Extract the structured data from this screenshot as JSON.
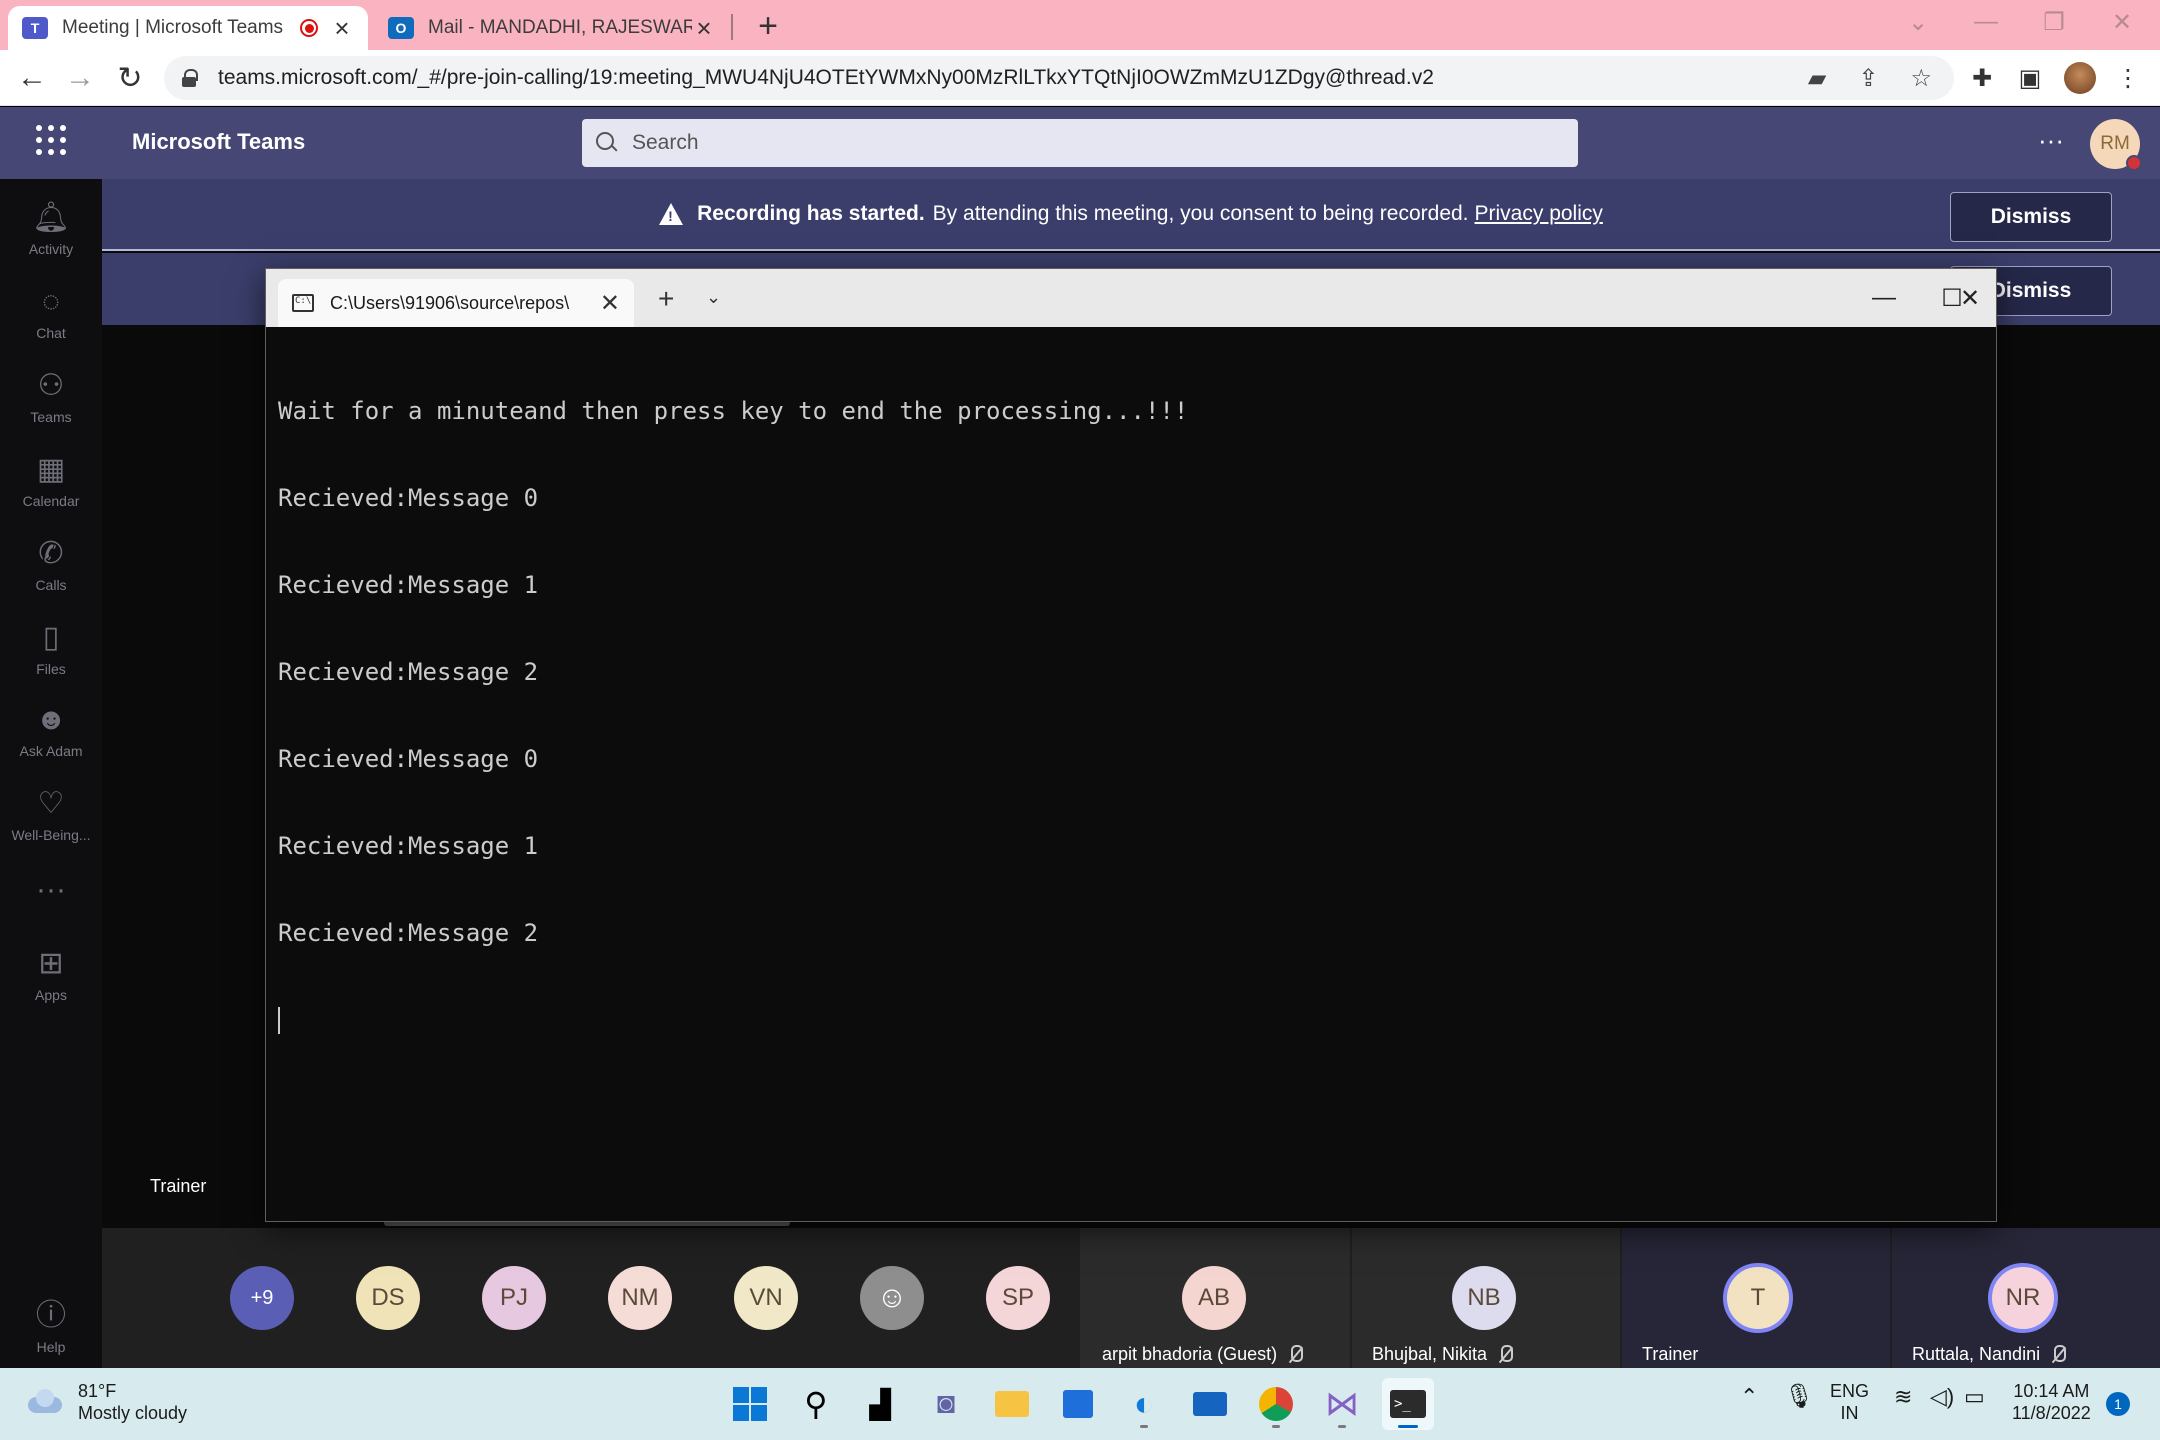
{
  "browser": {
    "tabs": [
      {
        "title": "Meeting | Microsoft Teams",
        "recording": true
      },
      {
        "title": "Mail - MANDADHI, RAJESWARI -"
      }
    ],
    "url": "teams.microsoft.com/_#/pre-join-calling/19:meeting_MWU4NjU4OTEtYWMxNy00MzRlLTkxYTQtNjI0OWZmMzU1ZDgy@thread.v2"
  },
  "teams": {
    "app_name": "Microsoft Teams",
    "search_placeholder": "Search",
    "user_initials": "RM",
    "rail": [
      {
        "label": "Activity",
        "icon": "bell-icon"
      },
      {
        "label": "Chat",
        "icon": "chat-icon"
      },
      {
        "label": "Teams",
        "icon": "teams-icon"
      },
      {
        "label": "Calendar",
        "icon": "calendar-icon"
      },
      {
        "label": "Calls",
        "icon": "phone-icon"
      },
      {
        "label": "Files",
        "icon": "file-icon"
      },
      {
        "label": "Ask Adam",
        "icon": "ask-adam-icon"
      },
      {
        "label": "Well-Being...",
        "icon": "well-being-icon"
      },
      {
        "label": "Apps",
        "icon": "apps-icon"
      },
      {
        "label": "Help",
        "icon": "help-icon"
      }
    ],
    "banner": {
      "bold": "Recording has started.",
      "text": "By attending this meeting, you consent to being recorded.",
      "link": "Privacy policy",
      "dismiss": "Dismiss"
    },
    "stage_label": "Trainer"
  },
  "participants": {
    "overflow": "+9",
    "avatars": [
      "DS",
      "PJ",
      "NM",
      "VN",
      "SP"
    ],
    "tiles": [
      {
        "initials": "AB",
        "name": "arpit bhadoria (Guest)",
        "muted": true
      },
      {
        "initials": "NB",
        "name": "Bhujbal, Nikita",
        "muted": true
      },
      {
        "initials": "T",
        "name": "Trainer",
        "muted": false
      },
      {
        "initials": "NR",
        "name": "Ruttala, Nandini",
        "muted": true
      }
    ]
  },
  "terminal": {
    "tab_title": "C:\\Users\\91906\\source\\repos\\",
    "lines": [
      "Wait for a minuteand then press key to end the processing...!!!",
      "Recieved:Message 0",
      "Recieved:Message 1",
      "Recieved:Message 2",
      "Recieved:Message 0",
      "Recieved:Message 1",
      "Recieved:Message 2"
    ]
  },
  "taskbar": {
    "temperature": "81°F",
    "weather": "Mostly cloudy",
    "language": "ENG",
    "region": "IN",
    "time": "10:14 AM",
    "date": "11/8/2022",
    "notifications": "1"
  },
  "colors": {
    "tabstrip": "#fab3c0",
    "teams_header": "#464775",
    "banner": "#3b3e6b",
    "taskbar": "#d7ebee"
  }
}
